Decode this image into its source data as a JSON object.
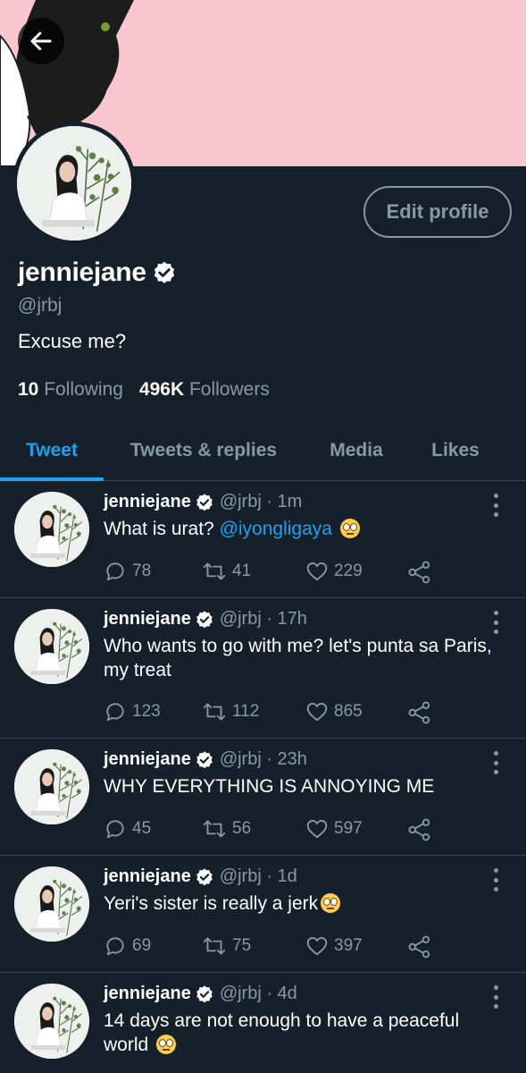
{
  "header": {
    "back_icon": "arrow-left-icon"
  },
  "profile": {
    "name": "jenniejane",
    "handle": "@jrbj",
    "bio": "Excuse me?",
    "following_count": "10",
    "following_label": "Following",
    "followers_count": "496K",
    "followers_label": "Followers",
    "edit_label": "Edit profile"
  },
  "tabs": [
    {
      "label": "Tweet",
      "active": true
    },
    {
      "label": "Tweets & replies"
    },
    {
      "label": "Media"
    },
    {
      "label": "Likes"
    }
  ],
  "colors": {
    "background": "#15202b",
    "accent": "#1da1f2",
    "muted": "#8899a6",
    "banner": "#f8c6cf"
  },
  "tweets": [
    {
      "name": "jenniejane",
      "meta": "@jrbj · 1m",
      "text": "What is urat?",
      "mention": "@iyongligaya",
      "emoji": "eye-roll-emoji",
      "replies": "78",
      "retweets": "41",
      "likes": "229"
    },
    {
      "name": "jenniejane",
      "meta": "@jrbj · 17h",
      "text": "Who wants to go with me? let's punta sa Paris, my treat",
      "replies": "123",
      "retweets": "112",
      "likes": "865"
    },
    {
      "name": "jenniejane",
      "meta": "@jrbj · 23h",
      "text": "WHY EVERYTHING IS ANNOYING ME",
      "replies": "45",
      "retweets": "56",
      "likes": "597"
    },
    {
      "name": "jenniejane",
      "meta": "@jrbj · 1d",
      "text": "Yeri's sister is really a jerk",
      "emoji": "smirk-emoji",
      "replies": "69",
      "retweets": "75",
      "likes": "397"
    },
    {
      "name": "jenniejane",
      "meta": "@jrbj · 4d",
      "text": "14 days are not enough to have a peaceful world",
      "emoji": "eye-roll-emoji"
    }
  ]
}
